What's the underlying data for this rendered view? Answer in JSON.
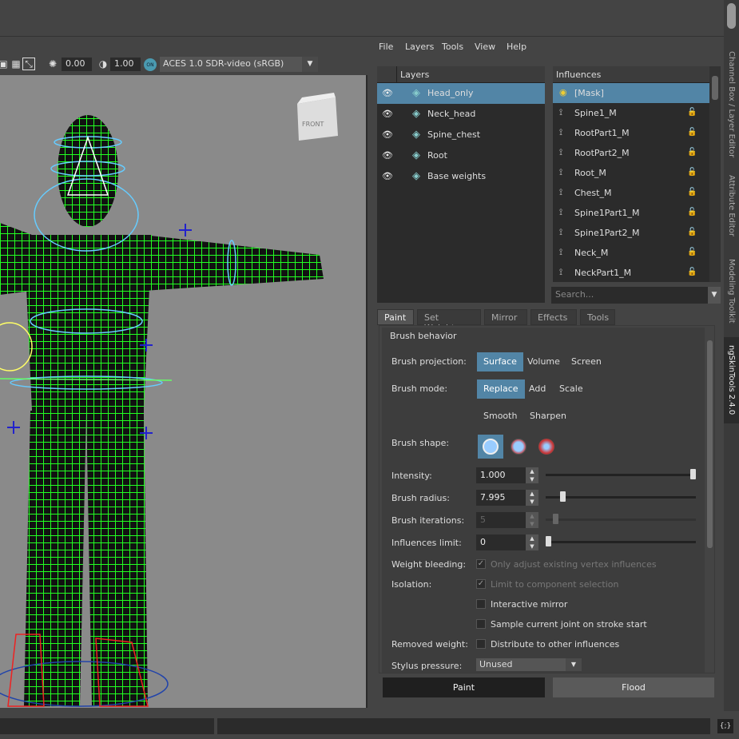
{
  "toolbar": {
    "field1": "0.00",
    "field2": "1.00",
    "on_icon": "ON",
    "colorspace": "ACES 1.0 SDR-video (sRGB)"
  },
  "viewcube": {
    "label": "FRONT"
  },
  "menu": [
    "File",
    "Layers",
    "Tools",
    "View",
    "Help"
  ],
  "layers": {
    "header": "Layers",
    "items": [
      {
        "name": "Head_only",
        "selected": true
      },
      {
        "name": "Neck_head"
      },
      {
        "name": "Spine_chest"
      },
      {
        "name": "Root"
      },
      {
        "name": "Base weights"
      }
    ]
  },
  "influences": {
    "header": "Influences",
    "items": [
      {
        "name": "[Mask]",
        "selected": true
      },
      {
        "name": "Spine1_M"
      },
      {
        "name": "RootPart1_M"
      },
      {
        "name": "RootPart2_M"
      },
      {
        "name": "Root_M"
      },
      {
        "name": "Chest_M"
      },
      {
        "name": "Spine1Part1_M"
      },
      {
        "name": "Spine1Part2_M"
      },
      {
        "name": "Neck_M"
      },
      {
        "name": "NeckPart1_M"
      }
    ],
    "search_placeholder": "Search..."
  },
  "tabs": [
    "Paint",
    "Set Weights",
    "Mirror",
    "Effects",
    "Tools"
  ],
  "brush": {
    "section": "Brush behavior",
    "projection_label": "Brush projection:",
    "projection_options": [
      "Surface",
      "Volume",
      "Screen"
    ],
    "mode_label": "Brush mode:",
    "mode_options": [
      "Replace",
      "Add",
      "Scale",
      "Smooth",
      "Sharpen"
    ],
    "shape_label": "Brush shape:",
    "intensity_label": "Intensity:",
    "intensity": "1.000",
    "intensity_level": 1.0,
    "radius_label": "Brush radius:",
    "radius": "7.995",
    "radius_level": 0.1,
    "iterations_label": "Brush iterations:",
    "iterations": "5",
    "iterations_level": 0.05,
    "limit_label": "Influences limit:",
    "limit": "0",
    "limit_level": 0.0,
    "bleeding_label": "Weight bleeding:",
    "bleeding_text": "Only adjust existing vertex influences",
    "isolation_label": "Isolation:",
    "isolation_text": "Limit to component selection",
    "interactive_mirror": "Interactive mirror",
    "sample_joint": "Sample current joint on stroke start",
    "removed_label": "Removed weight:",
    "removed_text": "Distribute to other influences",
    "stylus_label": "Stylus pressure:",
    "stylus_value": "Unused"
  },
  "buttons": {
    "paint": "Paint",
    "flood": "Flood"
  },
  "side_tabs": [
    "Channel Box / Layer Editor",
    "Attribute Editor",
    "Modeling Toolkit",
    "ngSkinTools 2.4.0"
  ],
  "statusbar": {
    "icon": "{;}"
  },
  "colors": {
    "accent": "#5285a6",
    "mesh": "#22ff22"
  }
}
